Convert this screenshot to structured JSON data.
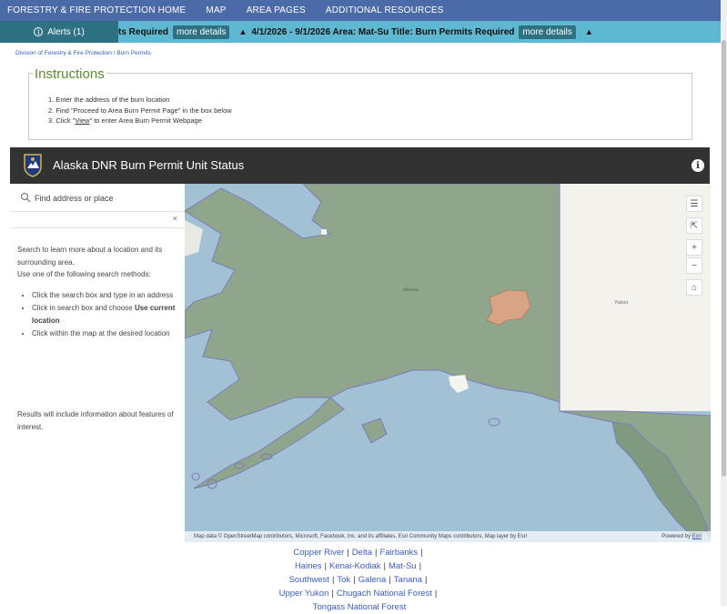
{
  "topnav": {
    "items": [
      "FORESTRY & FIRE PROTECTION HOME",
      "MAP",
      "AREA PAGES",
      "ADDITIONAL RESOURCES"
    ]
  },
  "alerts": {
    "button_label": "Alerts (1)",
    "ticker_prefix": "ts Required",
    "more_details": "more details",
    "ticker_main": "4/1/2026 - 9/1/2026 Area: Mat-Su Title: Burn Permits Required",
    "arrow": "▲"
  },
  "breadcrumb": {
    "home": "Division of Forestry & Fire Protection",
    "separator": "/",
    "current": "Burn Permits"
  },
  "instructions": {
    "title": "Instructions",
    "step1": "1. Enter the address of the burn location",
    "step2": "2. Find \"Proceed to Area Burn Permit Page\" in the box below",
    "step3_prefix": "3. Click \"",
    "step3_link": "View",
    "step3_suffix": "\" to enter Area Burn Permit Webpage"
  },
  "app": {
    "title": "Alaska DNR Burn Permit Unit Status",
    "info_glyph": "i"
  },
  "search": {
    "placeholder": "Find address or place",
    "clear": "×"
  },
  "sidepanel": {
    "intro": "Search to learn more about a location and its surrounding area.",
    "methods_label": "Use one of the following search methods:",
    "bullet1": "Click the search box and type in an address",
    "bullet2_prefix": "Click in search box and choose ",
    "bullet2_bold": "Use current location",
    "bullet3": "Click within the map at the desired location",
    "results": "Results will include information about features of interest."
  },
  "map": {
    "label_alaska": "Alaska",
    "label_yukon": "Yukon",
    "attribution": "Map data © OpenStreetMap contributors, Microsoft, Facebook, Inc. and its affiliates, Esri Community Maps contributors, Map layer by Esri",
    "powered_prefix": "Powered by ",
    "powered_link": "Esri",
    "controls": {
      "legend": "☰",
      "export": "⇱",
      "zoom_in": "+",
      "zoom_out": "−",
      "home": "⌂"
    },
    "colors": {
      "water": "#a3c1d5",
      "land": "#8fa68c",
      "highlight": "#d9a486",
      "canada": "#f3f2ec"
    }
  },
  "area_links": {
    "row1": [
      "Copper River",
      "Delta",
      "Fairbanks"
    ],
    "row2": [
      "Haines",
      "Kenai-Kodiak",
      "Mat-Su"
    ],
    "row3": [
      "Southwest",
      "Tok",
      "Galena",
      "Tanana"
    ],
    "row4": [
      "Upper Yukon",
      "Chugach National Forest"
    ],
    "row5": [
      "Tongass National Forest"
    ],
    "separator": "|"
  }
}
